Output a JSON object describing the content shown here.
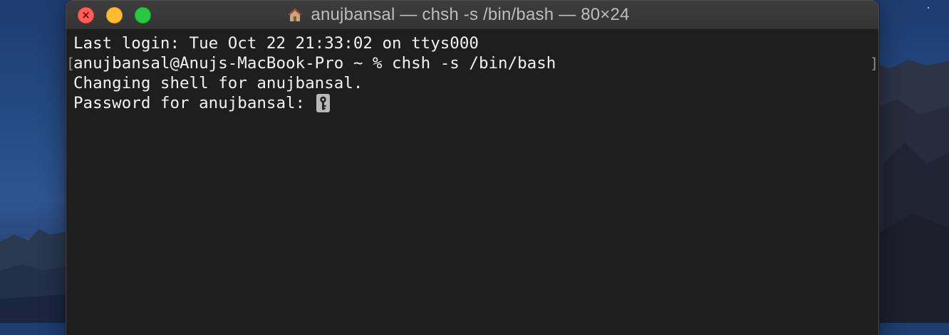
{
  "window": {
    "title": "anujbansal — chsh -s /bin/bash — 80×24",
    "title_icon": "home-icon",
    "traffic_lights": {
      "close": "#fe5f57",
      "minimize": "#febc2e",
      "zoom": "#28c840"
    }
  },
  "terminal": {
    "background": "#1e1e1e",
    "text_color": "#f2f2f2",
    "lines": [
      "Last login: Tue Oct 22 21:33:02 on ttys000",
      "anujbansal@Anujs-MacBook-Pro ~ % chsh -s /bin/bash",
      "Changing shell for anujbansal.",
      "Password for anujbansal: "
    ],
    "mark_left": "[",
    "mark_right": "]",
    "cursor_icon": "key-icon"
  }
}
